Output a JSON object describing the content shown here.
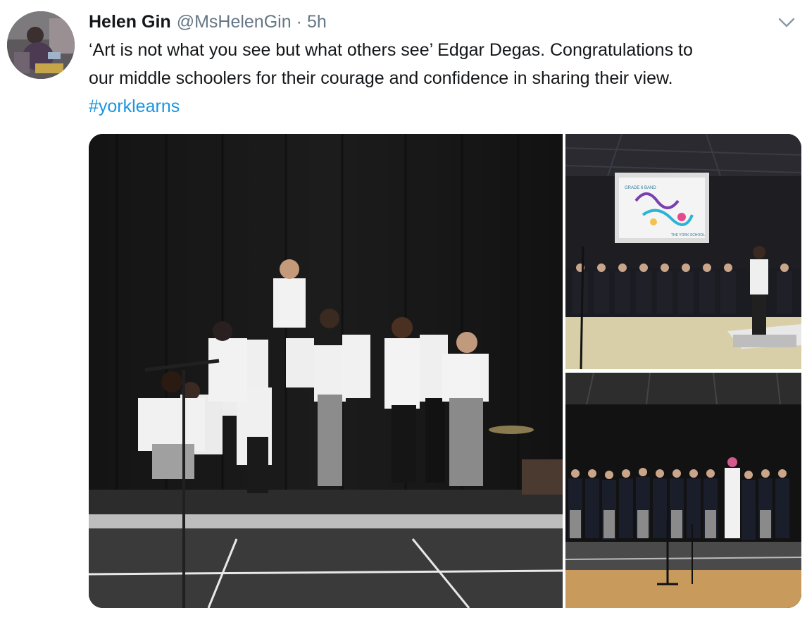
{
  "tweet": {
    "author": {
      "display_name": "Helen Gin",
      "handle": "@MsHelenGin"
    },
    "separator": "·",
    "time": "5h",
    "text_lines": [
      "‘Art is not what you see but what others see’ Edgar Degas. Congratulations to",
      "our middle schoolers for their courage and confidence in sharing their view."
    ],
    "hashtag": "#yorklearns",
    "screen_text": {
      "heading": "GRADE 6 BAND",
      "footer": "THE YORK SCHOOL"
    }
  },
  "icons": {
    "caret": "chevron-down-icon"
  },
  "colors": {
    "text": "#14171a",
    "secondary": "#657786",
    "link": "#1b95e0"
  }
}
